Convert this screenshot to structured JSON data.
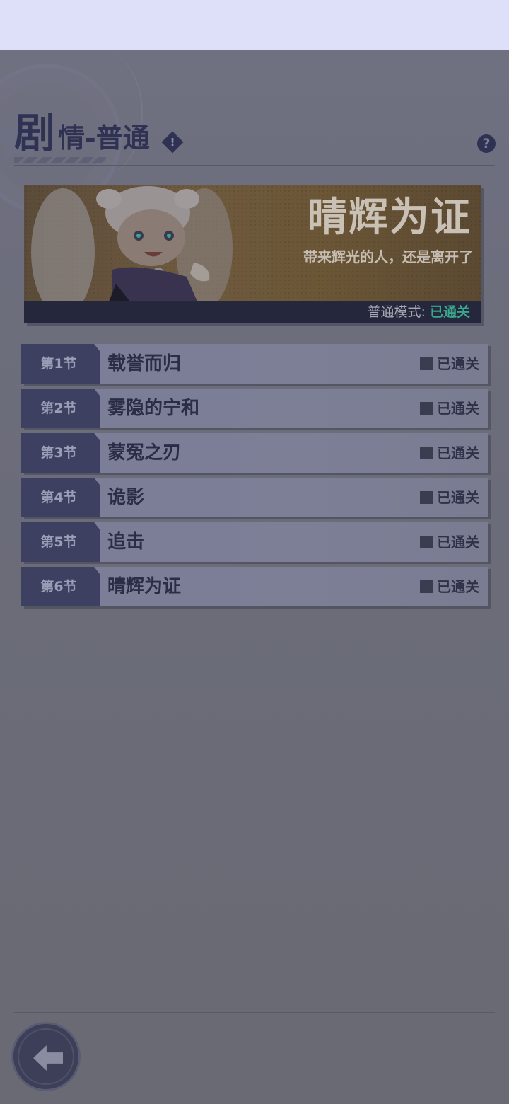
{
  "header": {
    "title_big": "剧",
    "title_rest": "情-普通",
    "info_icon": "exclamation-diamond-icon",
    "help_icon": "question-circle-icon"
  },
  "banner": {
    "title": "晴辉为证",
    "subtitle": "带来辉光的人，还是离开了",
    "mode_label": "普通模式:",
    "mode_status": "已通关",
    "status_color": "#3aa68c"
  },
  "chapters": [
    {
      "number": "第1节",
      "name": "载誉而归",
      "status": "已通关"
    },
    {
      "number": "第2节",
      "name": "雾隐的宁和",
      "status": "已通关"
    },
    {
      "number": "第3节",
      "name": "蒙冤之刃",
      "status": "已通关"
    },
    {
      "number": "第4节",
      "name": "诡影",
      "status": "已通关"
    },
    {
      "number": "第5节",
      "name": "追击",
      "status": "已通关"
    },
    {
      "number": "第6节",
      "name": "晴辉为证",
      "status": "已通关"
    }
  ],
  "footer": {
    "back_icon": "back-arrow-icon"
  }
}
